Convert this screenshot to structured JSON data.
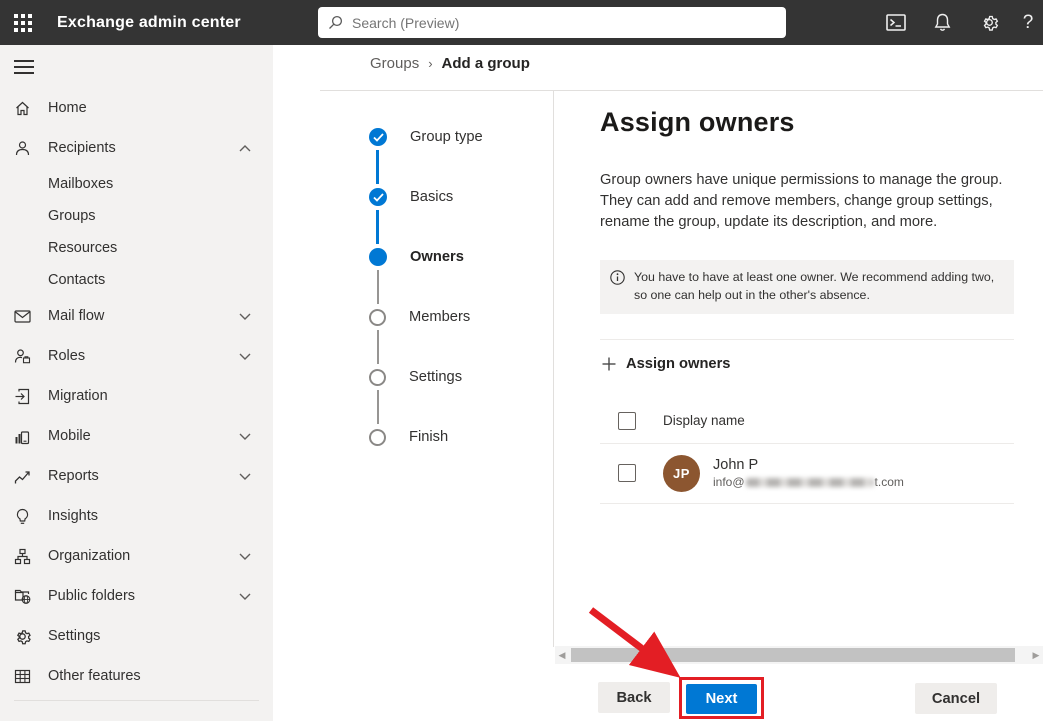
{
  "topbar": {
    "app_title": "Exchange admin center",
    "search_placeholder": "Search (Preview)",
    "help_label": "?",
    "icons": [
      "app-launcher-icon",
      "search-icon",
      "terminal-icon",
      "bell-icon",
      "gear-icon",
      "help-icon"
    ]
  },
  "sidebar": {
    "items": [
      {
        "label": "Home",
        "icon": "home-icon"
      },
      {
        "label": "Recipients",
        "icon": "person-icon",
        "chevron": "up"
      },
      {
        "label": "Mailboxes",
        "indent": true
      },
      {
        "label": "Groups",
        "indent": true
      },
      {
        "label": "Resources",
        "indent": true
      },
      {
        "label": "Contacts",
        "indent": true
      },
      {
        "label": "Mail flow",
        "icon": "mail-icon",
        "chevron": "down"
      },
      {
        "label": "Roles",
        "icon": "person-badge-icon",
        "chevron": "down"
      },
      {
        "label": "Migration",
        "icon": "migration-icon"
      },
      {
        "label": "Mobile",
        "icon": "mobile-icon",
        "chevron": "down"
      },
      {
        "label": "Reports",
        "icon": "line-chart-icon",
        "chevron": "down"
      },
      {
        "label": "Insights",
        "icon": "lightbulb-icon"
      },
      {
        "label": "Organization",
        "icon": "org-chart-icon",
        "chevron": "down"
      },
      {
        "label": "Public folders",
        "icon": "folder-globe-icon",
        "chevron": "down"
      },
      {
        "label": "Settings",
        "icon": "gear-icon"
      },
      {
        "label": "Other features",
        "icon": "grid-icon"
      }
    ]
  },
  "breadcrumb": {
    "parent": "Groups",
    "separator": "›",
    "current": "Add a group"
  },
  "wizard": {
    "steps": [
      {
        "label": "Group type",
        "state": "completed"
      },
      {
        "label": "Basics",
        "state": "completed"
      },
      {
        "label": "Owners",
        "state": "current"
      },
      {
        "label": "Members",
        "state": "upcoming"
      },
      {
        "label": "Settings",
        "state": "upcoming"
      },
      {
        "label": "Finish",
        "state": "upcoming"
      }
    ]
  },
  "main": {
    "heading": "Assign owners",
    "description": "Group owners have unique permissions to manage the group. They can add and remove members, change group settings, rename the group, update its description, and more.",
    "info_message": "You have to have at least one owner. We recommend adding two, so one can help out in the other's absence.",
    "assign_owners_button": "Assign owners",
    "table": {
      "column_header": "Display name",
      "rows": [
        {
          "initials": "JP",
          "name": "John P",
          "email_prefix": "info@",
          "email_suffix": "t.com",
          "email_redacted": true,
          "avatar_color": "#8c5630"
        }
      ]
    }
  },
  "footer": {
    "back": "Back",
    "next": "Next",
    "cancel": "Cancel"
  },
  "colors": {
    "accent": "#0078d4",
    "topbar_bg": "#343434",
    "sidebar_bg": "#f3f2f1",
    "annotation_red": "#e31e24",
    "avatar": "#8c5630",
    "info_bg": "#f3f2f1"
  }
}
